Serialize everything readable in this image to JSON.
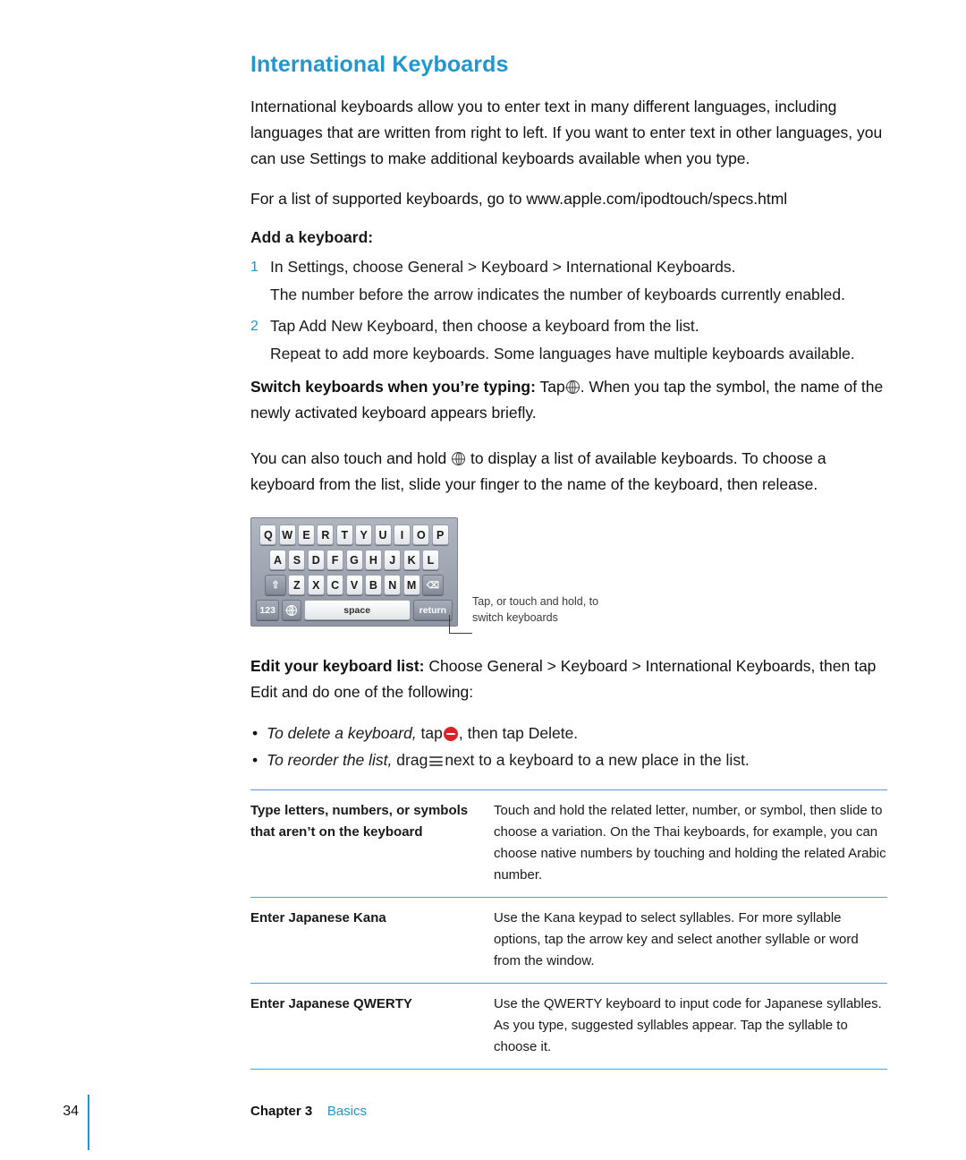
{
  "page": {
    "title": "International Keyboards",
    "paragraphs": {
      "intro": "International keyboards allow you to enter text in many different languages, including languages that are written from right to left. If you want to enter text in other languages, you can use Settings to make additional keyboards available when you type.",
      "specs": "For a list of supported keyboards, go to www.apple.com/ipodtouch/specs.html",
      "add_heading": "Add a keyboard:",
      "step1_num": "1",
      "step1": "In Settings, choose General > Keyboard > International Keyboards.",
      "step1_note": "The number before the arrow indicates the number of keyboards currently enabled.",
      "step2_num": "2",
      "step2": "Tap Add New Keyboard, then choose a keyboard from the list.",
      "step2_note": "Repeat to add more keyboards. Some languages have multiple keyboards available.",
      "switch_runin": "Switch keyboards when you’re typing:",
      "switch_text_a": "Tap",
      "switch_text_b": ". When you tap the symbol, the name of the newly activated keyboard appears briefly.",
      "hold_a": "You can also touch and hold",
      "hold_b": "to display a list of available keyboards. To choose a keyboard from the list, slide your finger to the name of the keyboard, then release.",
      "edit_runin": "Edit your keyboard list:",
      "edit_text": "Choose General > Keyboard > International Keyboards, then tap Edit and do one of the following:",
      "bullet1_ital": "To delete a keyboard,",
      "bullet1_a": "tap",
      "bullet1_b": ", then tap Delete.",
      "bullet2_ital": "To reorder the list,",
      "bullet2_a": "drag",
      "bullet2_b": "next to a keyboard to a new place in the list."
    },
    "keyboard": {
      "row1": [
        "Q",
        "W",
        "E",
        "R",
        "T",
        "Y",
        "U",
        "I",
        "O",
        "P"
      ],
      "row2": [
        "A",
        "S",
        "D",
        "F",
        "G",
        "H",
        "J",
        "K",
        "L"
      ],
      "row3": [
        "Z",
        "X",
        "C",
        "V",
        "B",
        "N",
        "M"
      ],
      "shift_label": "⇧",
      "delete_label": "⌫",
      "num_label": "123",
      "globe_label": "globe-icon",
      "space_label": "space",
      "return_label": "return"
    },
    "callout": "Tap, or touch and hold, to switch keyboards",
    "table": [
      {
        "label": "Type letters, numbers, or symbols that aren’t on the keyboard",
        "desc": "Touch and hold the related letter, number, or symbol, then slide to choose a variation. On the Thai keyboards, for example, you can choose native numbers by touching and holding the related Arabic number."
      },
      {
        "label": "Enter Japanese Kana",
        "desc": "Use the Kana keypad to select syllables. For more syllable options, tap the arrow key and select another syllable or word from the window."
      },
      {
        "label": "Enter Japanese QWERTY",
        "desc": "Use the QWERTY keyboard to input code for Japanese syllables. As you type, suggested syllables appear. Tap the syllable to choose it."
      }
    ],
    "footer": {
      "page_number": "34",
      "chapter": "Chapter 3",
      "section": "Basics"
    }
  }
}
